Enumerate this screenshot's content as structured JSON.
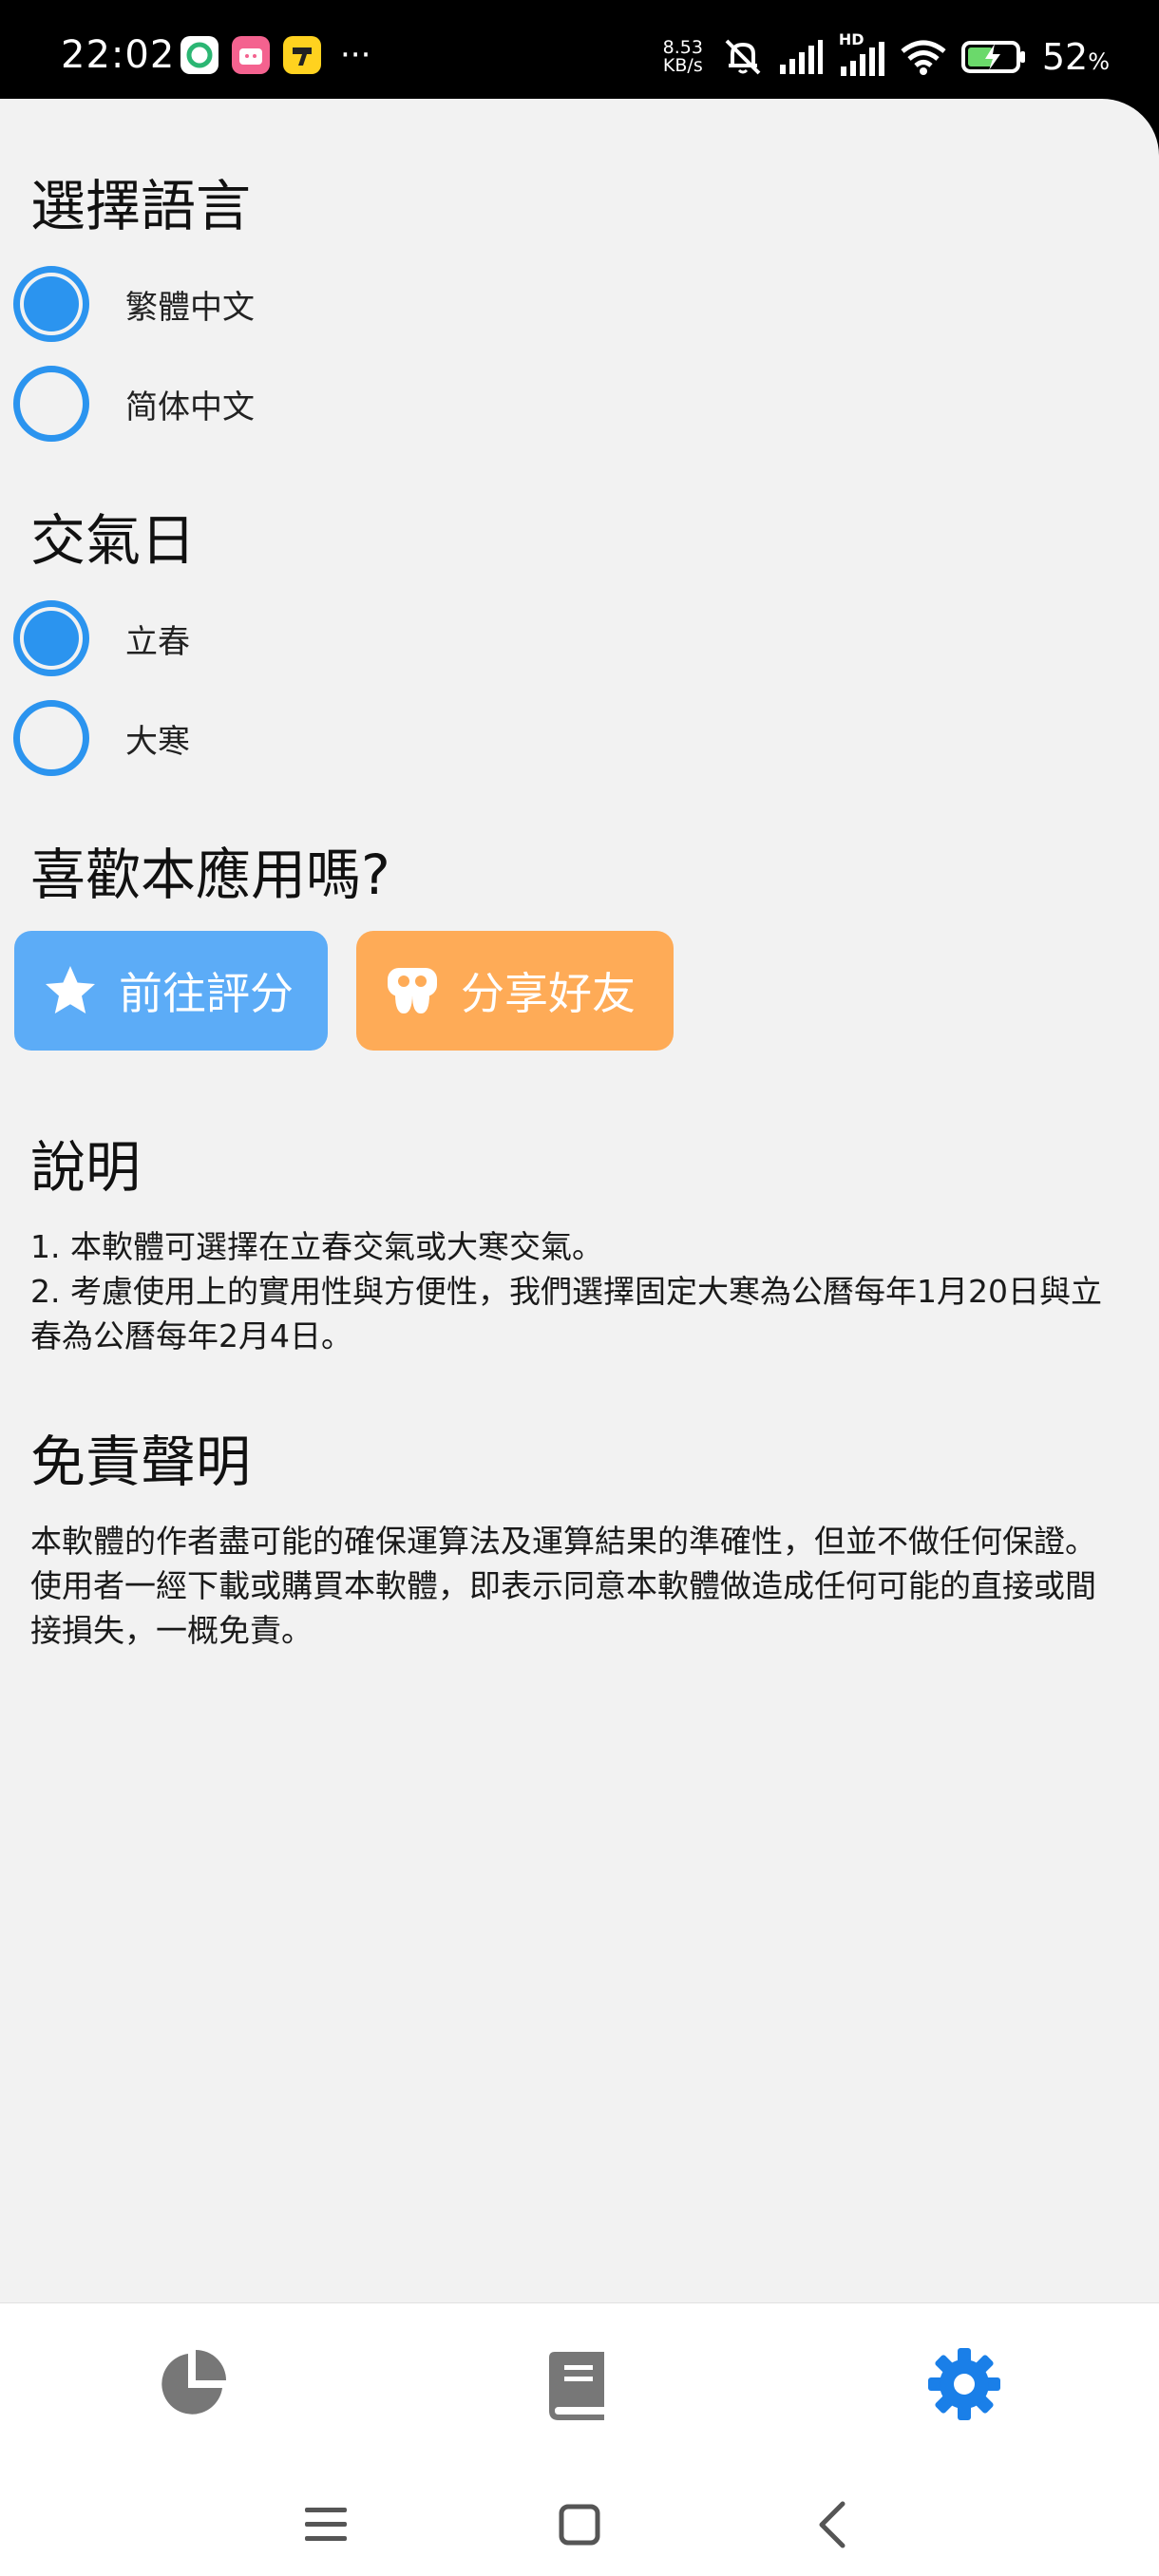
{
  "status_bar": {
    "time": "22:02",
    "more": "···",
    "net_speed_value": "8.53",
    "net_speed_unit": "KB/s",
    "hd": "HD",
    "battery_percent": "52",
    "battery_unit": "%"
  },
  "language": {
    "title": "選擇語言",
    "options": [
      {
        "label": "繁體中文",
        "selected": true
      },
      {
        "label": "简体中文",
        "selected": false
      }
    ]
  },
  "solar_term": {
    "title": "交氣日",
    "options": [
      {
        "label": "立春",
        "selected": true
      },
      {
        "label": "大寒",
        "selected": false
      }
    ]
  },
  "like_app": {
    "title": "喜歡本應用嗎?",
    "rate_label": "前往評分",
    "share_label": "分享好友",
    "rate_color": "#5cacf7",
    "share_color": "#feab57"
  },
  "explanation": {
    "title": "說明",
    "line1": "1. 本軟體可選擇在立春交氣或大寒交氣。",
    "line2": "2. 考慮使用上的實用性與方便性，我們選擇固定大寒為公曆每年1月20日與立春為公曆每年2月4日。"
  },
  "disclaimer": {
    "title": "免責聲明",
    "text": "本軟體的作者盡可能的確保運算法及運算結果的準確性，但並不做任何保證。使用者一經下載或購買本軟體，即表示同意本軟體做造成任何可能的直接或間接損失，一概免責。"
  },
  "bottom_nav": {
    "items": [
      {
        "icon": "pie-chart-icon",
        "active": false
      },
      {
        "icon": "book-icon",
        "active": false
      },
      {
        "icon": "gear-icon",
        "active": true
      }
    ],
    "active_color": "#1a7fe8",
    "inactive_color": "#777777"
  },
  "system_nav": {
    "items": [
      "menu-icon",
      "home-icon",
      "back-icon"
    ]
  }
}
